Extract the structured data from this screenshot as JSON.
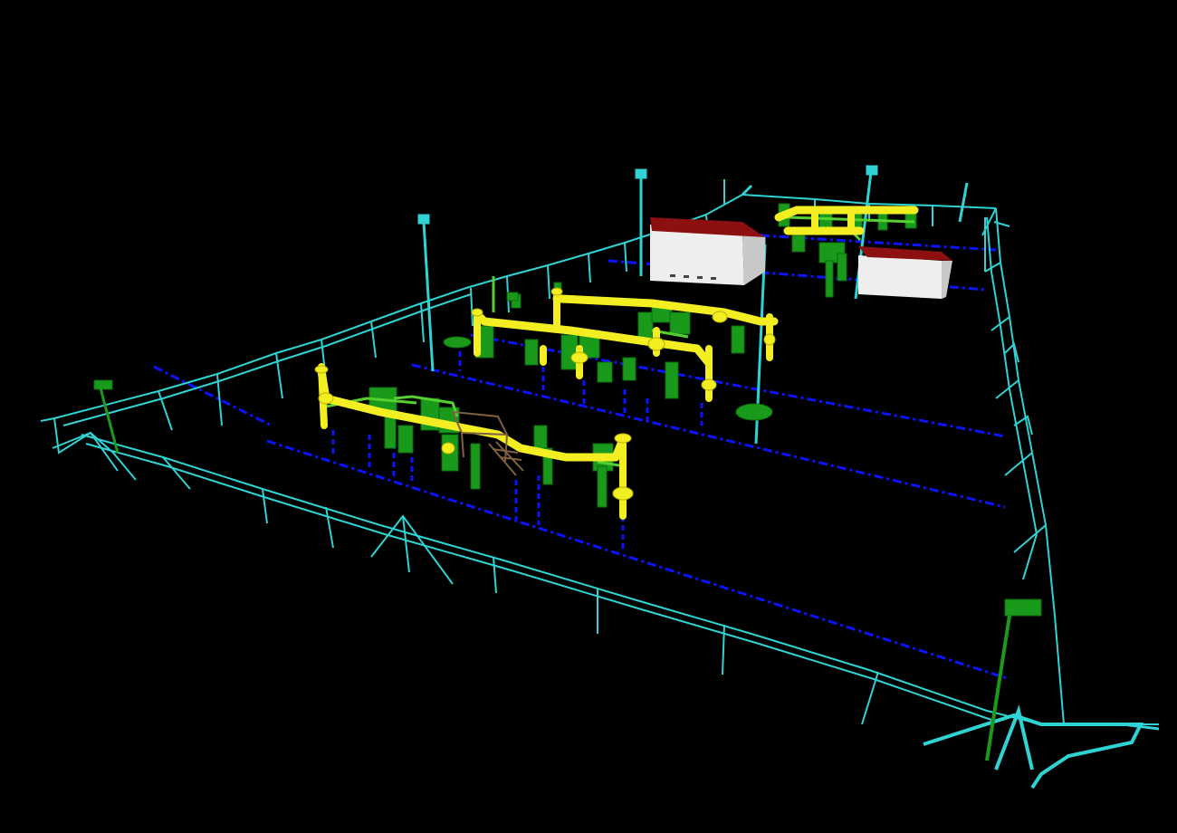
{
  "viewport": {
    "background": "#000000",
    "colors": {
      "fence": "#2fd3d3",
      "grid": "#0a14ff",
      "pipe": "#f2ee22",
      "pipe_dark": "#b9b000",
      "equipment": "#1a9a1a",
      "equipment_light": "#55d030",
      "building_wall": "#eeeeee",
      "building_roof": "#8c1010"
    },
    "icons": [
      "fence-icon",
      "lamp-post-icon",
      "building-icon",
      "pipe-icon",
      "valve-icon",
      "flag-icon"
    ]
  }
}
